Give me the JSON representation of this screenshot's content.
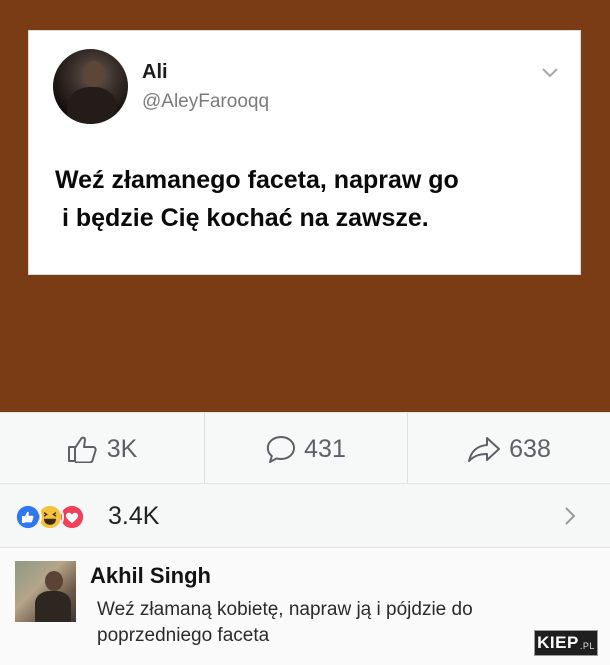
{
  "tweet": {
    "author_name": "Ali",
    "handle": "@AleyFarooqq",
    "text": "Weź złamanego faceta, napraw go\n i będzie Cię kochać na zawsze.",
    "avatar_icon": "profile-photo",
    "menu_icon": "chevron-down-icon",
    "background_color": "#7a3c15"
  },
  "actions": {
    "likes": "3K",
    "comments": "431",
    "shares": "638",
    "like_icon": "thumbs-up-icon",
    "comment_icon": "comment-bubble-icon",
    "share_icon": "share-arrow-icon"
  },
  "reactions": {
    "count": "3.4K",
    "icons": [
      "like-reaction-icon",
      "haha-reaction-icon",
      "love-reaction-icon"
    ],
    "colors": {
      "like": "#2f77f1",
      "haha": "#f5c33b",
      "love": "#f0405a"
    }
  },
  "comment": {
    "author": "Akhil Singh",
    "text": "Weź złamaną kobietę, napraw ją i pójdzie do poprzedniego faceta"
  },
  "watermark": {
    "text": "KIEP",
    "suffix": ".PL"
  }
}
